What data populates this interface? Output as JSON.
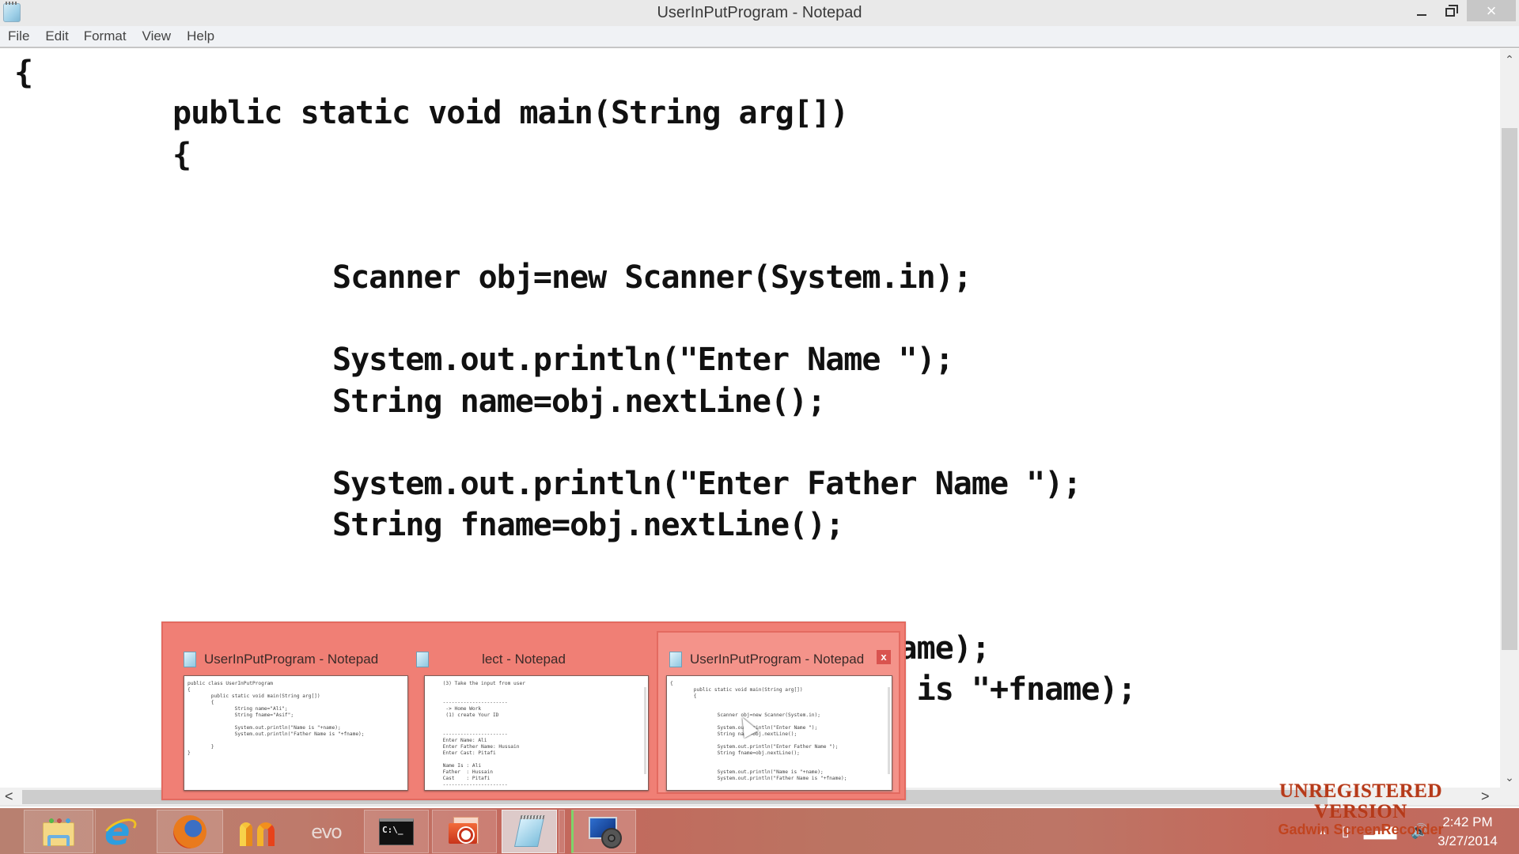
{
  "window": {
    "title": "UserInPutProgram - Notepad",
    "icon": "notepad-icon",
    "controls": {
      "minimize": "minimize-icon",
      "maximize": "restore-icon",
      "close": "×"
    }
  },
  "menu": {
    "items": [
      "File",
      "Edit",
      "Format",
      "View",
      "Help"
    ]
  },
  "editor": {
    "lines": [
      {
        "indent": 0,
        "text": "{"
      },
      {
        "indent": 1,
        "text": "public static void main(String arg[])"
      },
      {
        "indent": 1,
        "text": "{"
      },
      {
        "indent": 2,
        "text": "Scanner obj=new Scanner(System.in);"
      },
      {
        "indent": 2,
        "text": "System.out.println(\"Enter Name \");"
      },
      {
        "indent": 2,
        "text": "String name=obj.nextLine();"
      },
      {
        "indent": 2,
        "text": "System.out.println(\"Enter Father Name \");"
      },
      {
        "indent": 2,
        "text": "String fname=obj.nextLine();"
      },
      {
        "indent": 2,
        "text": "System.out.println(\"Name is \"+name);"
      },
      {
        "indent": 2,
        "text": "System.out.println(\"Father Name is \"+fname);"
      }
    ],
    "visible_partial": [
      "'+name);",
      "ame is \"+fname);"
    ],
    "vertical_scroll": {
      "up": "^",
      "down": "v"
    },
    "horizontal_scroll": {
      "left": "<",
      "right": ">"
    }
  },
  "watermark": {
    "line1": "UNREGISTERED VERSION",
    "line2": "Gadwin ScreenRecorder"
  },
  "thumbnail_popup": {
    "cards": [
      {
        "title": "UserInPutProgram - Notepad",
        "preview": "public class UserInPutProgram\n{\n        public static void main(String arg[])\n        {\n                String name=\"Ali\";\n                String fname=\"Asif\";\n\n                System.out.println(\"Name is \"+name);\n                System.out.println(\"Father Name is \"+fname);\n\n        }\n}"
      },
      {
        "title": "lect - Notepad",
        "preview": "     (3) Take the input from user\n\n\n     ----------------------\n      -> Home Work\n      (1) create Your ID\n\n\n     ----------------------\n     Enter Name: Ali\n     Enter Father Name: Hussain\n     Enter Cast: Pitafi\n\n     Name Is : Ali\n     Father  : Hussain\n     Cast    : Pitafi\n     ----------------------"
      },
      {
        "title": "UserInPutProgram - Notepad",
        "close_label": "x",
        "preview": "{\n        public static void main(String arg[])\n        {\n\n\n                Scanner obj=new Scanner(System.in);\n\n                System.out.println(\"Enter Name \");\n                String name=obj.nextLine();\n\n                System.out.println(\"Enter Father Name \");\n                String fname=obj.nextLine();\n\n\n                System.out.println(\"Name is \"+name);\n                System.out.println(\"Father Name is \"+fname);"
      }
    ]
  },
  "taskbar": {
    "items": [
      {
        "name": "file-explorer",
        "icon": "folder-icon"
      },
      {
        "name": "internet-explorer",
        "icon": "ie-icon"
      },
      {
        "name": "firefox",
        "icon": "firefox-icon"
      },
      {
        "name": "m-app",
        "icon": "m-logo-icon"
      },
      {
        "name": "evo",
        "icon": "evo-icon",
        "label": "evo"
      },
      {
        "name": "command-prompt",
        "icon": "cmd-icon",
        "label": "C:\\_"
      },
      {
        "name": "powerpoint",
        "icon": "powerpoint-icon"
      },
      {
        "name": "notepad",
        "icon": "notepad-icon"
      },
      {
        "name": "screen-recorder",
        "icon": "recorder-icon"
      }
    ],
    "tray": {
      "show_hidden": "▲",
      "icons": [
        "power-icon",
        "network-icon",
        "volume-icon"
      ]
    },
    "clock": {
      "time": "2:42 PM",
      "date": "3/27/2014"
    }
  }
}
